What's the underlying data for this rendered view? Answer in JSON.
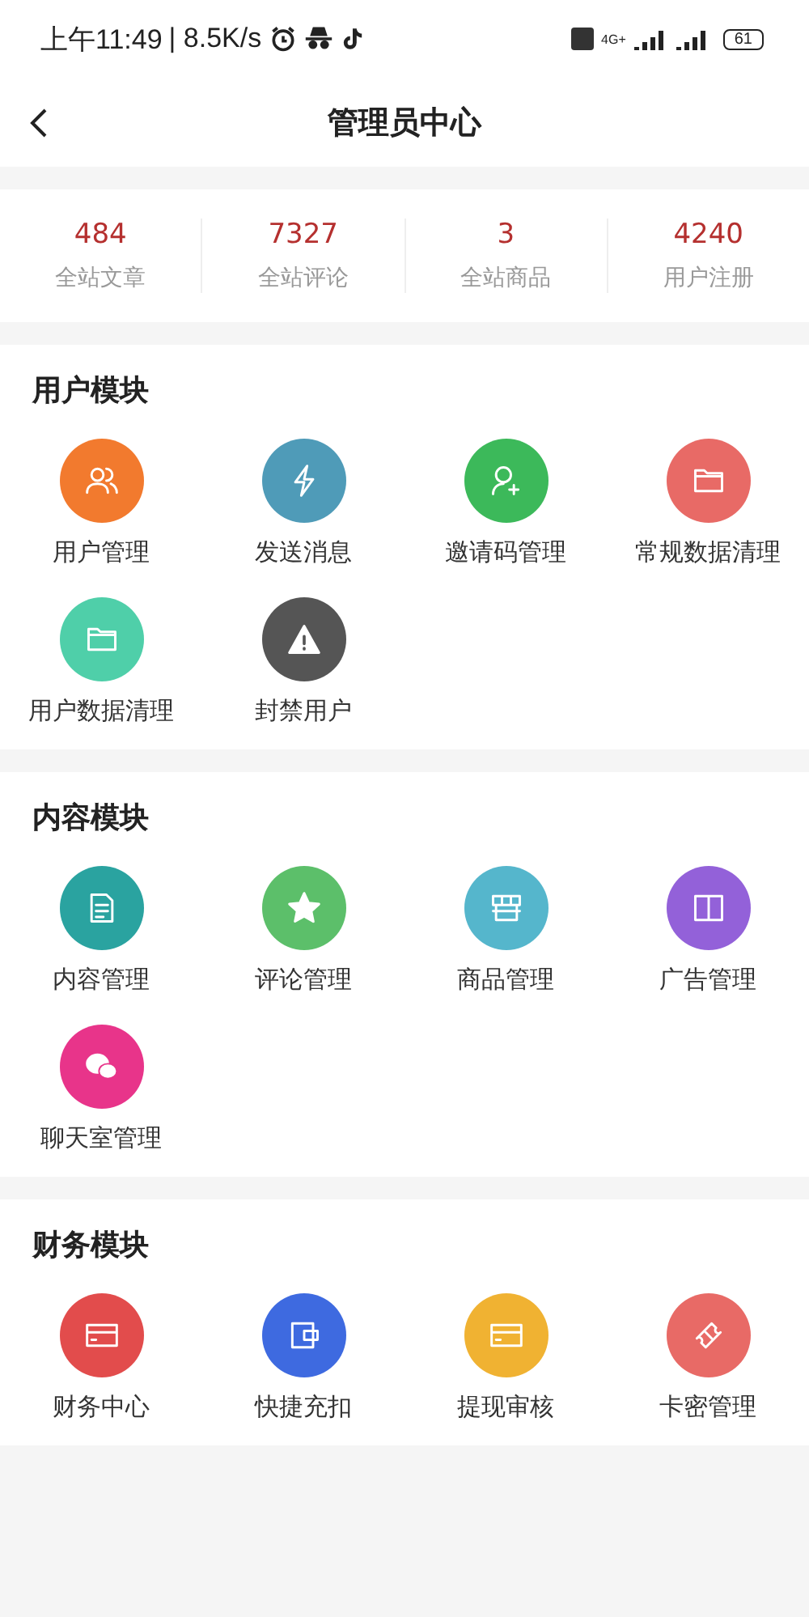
{
  "status_bar": {
    "time": "上午11:49",
    "speed": "| 8.5K/s",
    "network": "4G+",
    "battery": "61"
  },
  "header": {
    "title": "管理员中心"
  },
  "stats": [
    {
      "value": "484",
      "label": "全站文章"
    },
    {
      "value": "7327",
      "label": "全站评论"
    },
    {
      "value": "3",
      "label": "全站商品"
    },
    {
      "value": "4240",
      "label": "用户注册"
    }
  ],
  "sections": [
    {
      "title": "用户模块",
      "items": [
        {
          "label": "用户管理",
          "kind": "users",
          "color": "#f27a2e"
        },
        {
          "label": "发送消息",
          "kind": "bolt",
          "color": "#4f9bb8"
        },
        {
          "label": "邀请码管理",
          "kind": "user-plus",
          "color": "#3cb95a"
        },
        {
          "label": "常规数据清理",
          "kind": "folder",
          "color": "#e86a66"
        },
        {
          "label": "用户数据清理",
          "kind": "folder",
          "color": "#4fcfa9"
        },
        {
          "label": "封禁用户",
          "kind": "warning",
          "color": "#555555"
        }
      ]
    },
    {
      "title": "内容模块",
      "items": [
        {
          "label": "内容管理",
          "kind": "document",
          "color": "#2aa3a0"
        },
        {
          "label": "评论管理",
          "kind": "star",
          "color": "#5cbf6a"
        },
        {
          "label": "商品管理",
          "kind": "store",
          "color": "#55b6cc"
        },
        {
          "label": "广告管理",
          "kind": "book",
          "color": "#9361d9"
        },
        {
          "label": "聊天室管理",
          "kind": "chat",
          "color": "#e8348a"
        }
      ]
    },
    {
      "title": "财务模块",
      "items": [
        {
          "label": "财务中心",
          "kind": "card",
          "color": "#e24c4c"
        },
        {
          "label": "快捷充扣",
          "kind": "wallet",
          "color": "#3e6ae0"
        },
        {
          "label": "提现审核",
          "kind": "card",
          "color": "#f0b232"
        },
        {
          "label": "卡密管理",
          "kind": "ticket",
          "color": "#e86a66"
        }
      ]
    }
  ]
}
